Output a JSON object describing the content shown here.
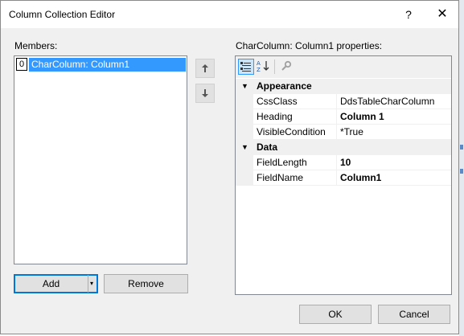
{
  "window": {
    "title": "Column Collection Editor",
    "help_label": "?",
    "close_label": "✕"
  },
  "members": {
    "label": "Members:",
    "items": [
      {
        "index": "0",
        "text": "CharColumn: Column1",
        "selected": true
      }
    ],
    "move_up_icon": "arrow-up-icon",
    "move_down_icon": "arrow-down-icon"
  },
  "buttons": {
    "add": "Add",
    "add_dropdown": "▾",
    "remove": "Remove",
    "ok": "OK",
    "cancel": "Cancel"
  },
  "properties": {
    "label": "CharColumn: Column1 properties:",
    "toolbar": [
      "categorized-icon",
      "alphabetical-icon",
      "property-pages-icon"
    ],
    "categories": [
      {
        "name": "Appearance",
        "expand_glyph": "▼",
        "items": [
          {
            "name": "CssClass",
            "value": "DdsTableCharColumn",
            "bold": false
          },
          {
            "name": "Heading",
            "value": "Column 1",
            "bold": true
          },
          {
            "name": "VisibleCondition",
            "value": "*True",
            "bold": false
          }
        ]
      },
      {
        "name": "Data",
        "expand_glyph": "▼",
        "items": [
          {
            "name": "FieldLength",
            "value": "10",
            "bold": true
          },
          {
            "name": "FieldName",
            "value": "Column1",
            "bold": true
          }
        ]
      }
    ]
  },
  "colors": {
    "selection": "#3399ff",
    "dialog_bg": "#f0f0f0",
    "focus_border": "#0078d7"
  }
}
